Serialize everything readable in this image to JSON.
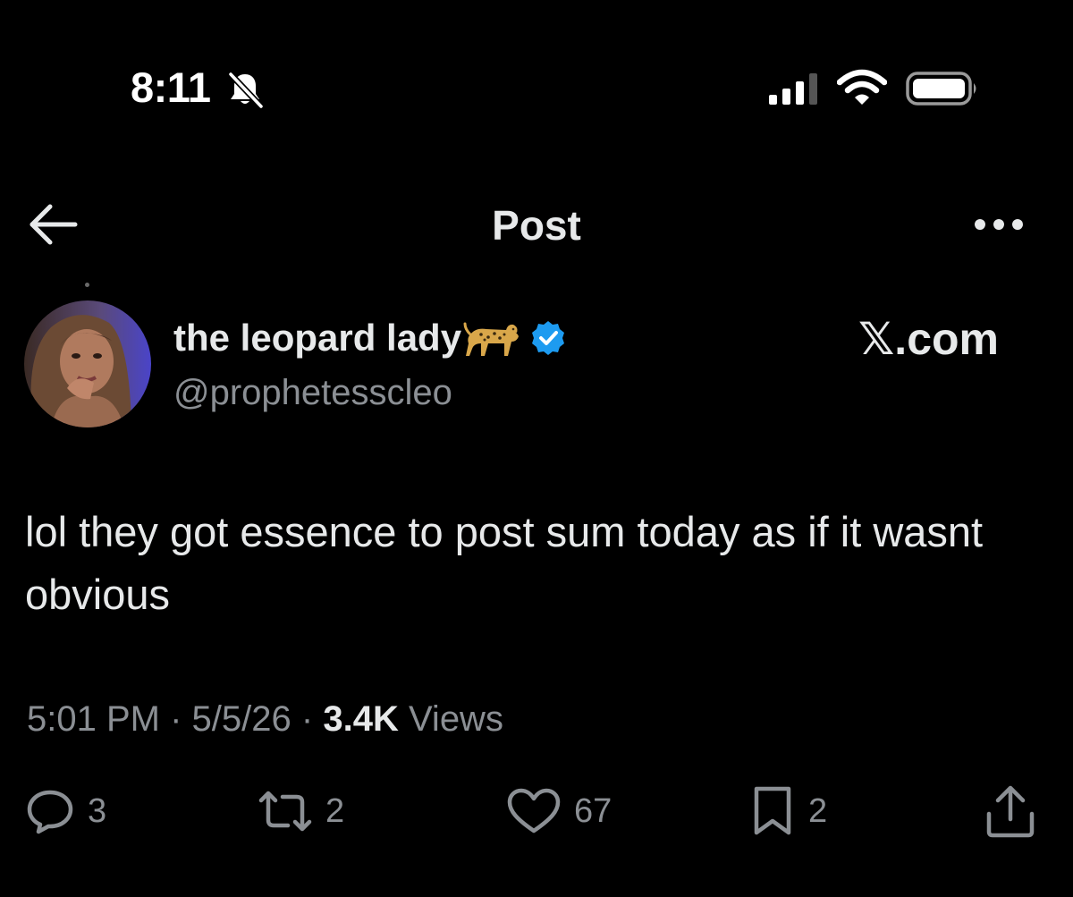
{
  "status_bar": {
    "time": "8:11",
    "icons": [
      "bell-slash-icon",
      "cellular-signal-icon",
      "wifi-icon",
      "battery-icon"
    ]
  },
  "header": {
    "title": "Post",
    "back_icon": "arrow-left-icon",
    "more_icon": "ellipsis-icon"
  },
  "post": {
    "author": {
      "display_name": "the leopard lady",
      "handle": "@prophetesscleo",
      "name_emoji": "leopard-icon",
      "verified": true
    },
    "source_label_x": "𝕏",
    "source_label_rest": ".com",
    "text": "lol they got essence to post sum today as if it wasnt obvious",
    "meta": {
      "time": "5:01 PM",
      "date": "5/5/26",
      "views_count": "3.4K",
      "views_label": "Views",
      "separator": "·"
    },
    "actions": {
      "replies": "3",
      "reposts": "2",
      "likes": "67",
      "bookmarks": "2"
    }
  },
  "colors": {
    "background": "#000000",
    "text_primary": "#e7e9ea",
    "text_secondary": "#8b8f94",
    "verified_blue": "#1d9bf0"
  }
}
